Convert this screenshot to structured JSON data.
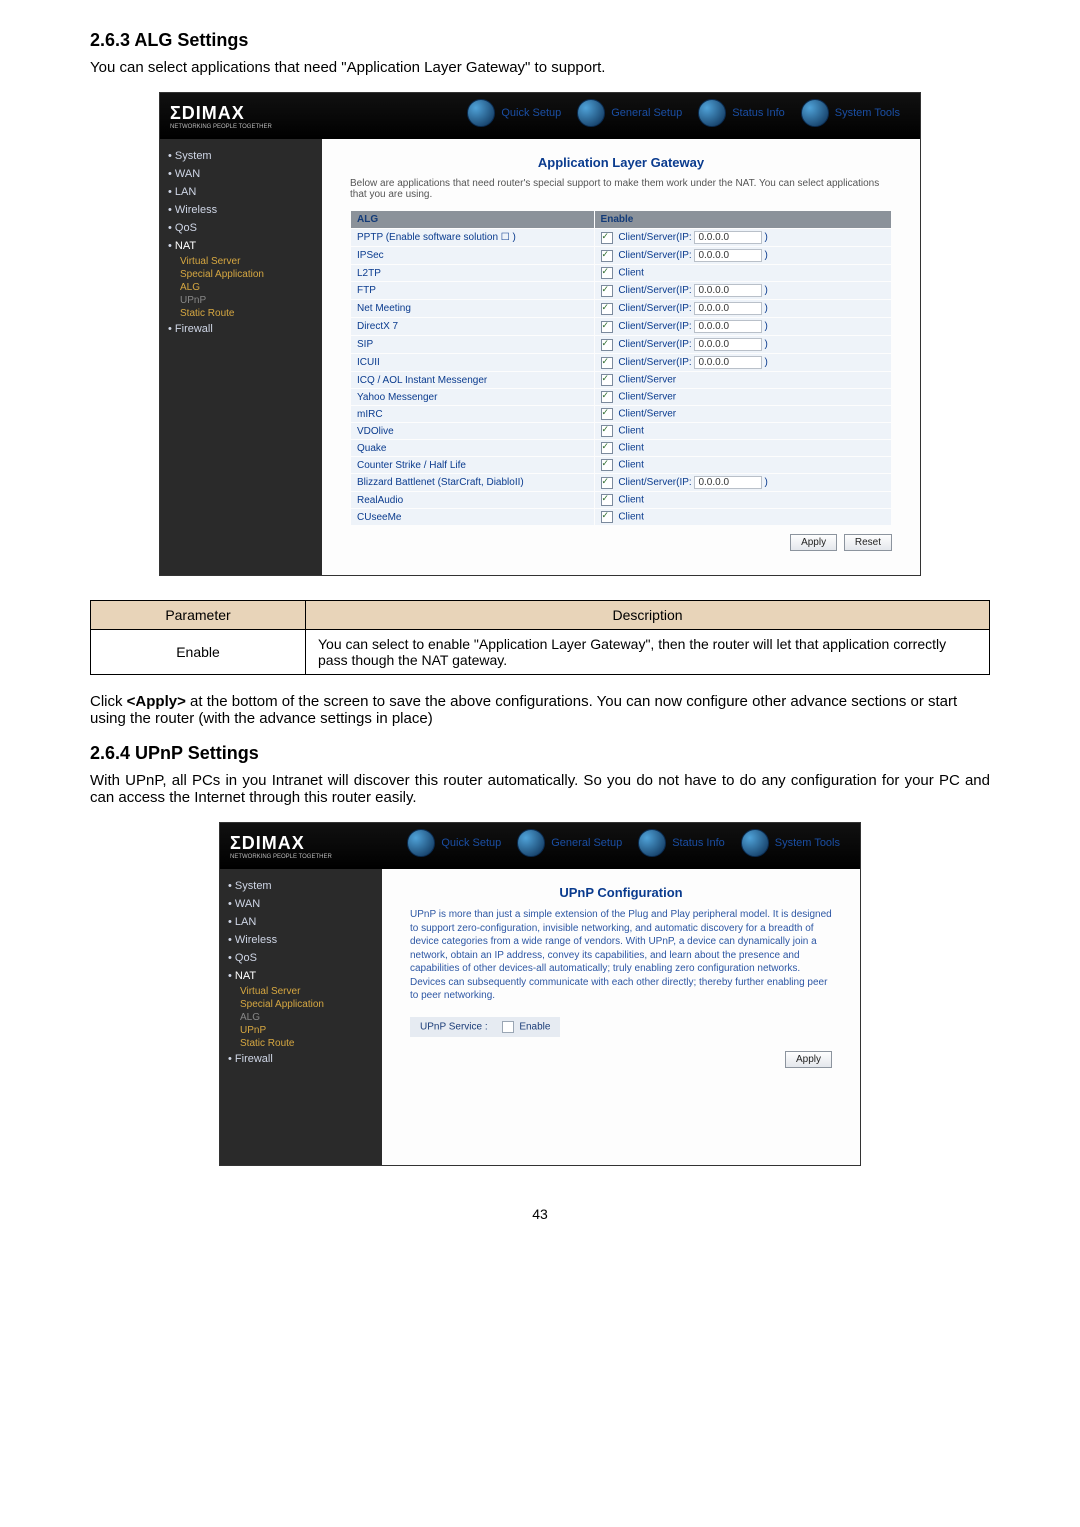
{
  "s263_heading": "2.6.3 ALG Settings",
  "s263_intro": "You can select applications that need \"Application Layer Gateway\" to support.",
  "brand": "ΣDIMAX",
  "brand_sub": "NETWORKING PEOPLE TOGETHER",
  "top_tabs": {
    "quick": "Quick Setup",
    "general": "General Setup",
    "status": "Status Info",
    "tools": "System Tools"
  },
  "nav": {
    "system": "System",
    "wan": "WAN",
    "lan": "LAN",
    "wireless": "Wireless",
    "qos": "QoS",
    "nat": "NAT",
    "virtual": "Virtual Server",
    "special": "Special Application",
    "alg": "ALG",
    "upnp": "UPnP",
    "static_route": "Static Route",
    "firewall": "Firewall"
  },
  "alg": {
    "title": "Application Layer Gateway",
    "desc": "Below are applications that need router's special support to make them work under the NAT. You can select applications that you are using.",
    "col_alg": "ALG",
    "col_enable": "Enable",
    "rows": [
      {
        "name": "PPTP (Enable software solution ☐ )",
        "enable_label": "Client/Server(IP:",
        "ip": "0.0.0.0",
        "hasip": true
      },
      {
        "name": "IPSec",
        "enable_label": "Client/Server(IP:",
        "ip": "0.0.0.0",
        "hasip": true
      },
      {
        "name": "L2TP",
        "enable_label": "Client",
        "hasip": false
      },
      {
        "name": "FTP",
        "enable_label": "Client/Server(IP:",
        "ip": "0.0.0.0",
        "hasip": true
      },
      {
        "name": "Net Meeting",
        "enable_label": "Client/Server(IP:",
        "ip": "0.0.0.0",
        "hasip": true
      },
      {
        "name": "DirectX 7",
        "enable_label": "Client/Server(IP:",
        "ip": "0.0.0.0",
        "hasip": true
      },
      {
        "name": "SIP",
        "enable_label": "Client/Server(IP:",
        "ip": "0.0.0.0",
        "hasip": true
      },
      {
        "name": "ICUII",
        "enable_label": "Client/Server(IP:",
        "ip": "0.0.0.0",
        "hasip": true
      },
      {
        "name": "ICQ / AOL Instant Messenger",
        "enable_label": "Client/Server",
        "hasip": false
      },
      {
        "name": "Yahoo Messenger",
        "enable_label": "Client/Server",
        "hasip": false
      },
      {
        "name": "mIRC",
        "enable_label": "Client/Server",
        "hasip": false
      },
      {
        "name": "VDOlive",
        "enable_label": "Client",
        "hasip": false
      },
      {
        "name": "Quake",
        "enable_label": "Client",
        "hasip": false
      },
      {
        "name": "Counter Strike / Half Life",
        "enable_label": "Client",
        "hasip": false
      },
      {
        "name": "Blizzard Battlenet (StarCraft, DiabloII)",
        "enable_label": "Client/Server(IP:",
        "ip": "0.0.0.0",
        "hasip": true
      },
      {
        "name": "RealAudio",
        "enable_label": "Client",
        "hasip": false
      },
      {
        "name": "CUseeMe",
        "enable_label": "Client",
        "hasip": false
      }
    ],
    "apply": "Apply",
    "reset": "Reset"
  },
  "param_header_param": "Parameter",
  "param_header_desc": "Description",
  "param_row_label": "Enable",
  "param_row_desc": "You can select to enable \"Application Layer Gateway\", then the router will let that application correctly pass though the NAT gateway.",
  "apply_note_prefix": "Click ",
  "apply_note_bold": "<Apply>",
  "apply_note_suffix": " at the bottom of the screen to save the above configurations. You can now configure other advance sections or start using the router (with the advance settings in place)",
  "s264_heading": "2.6.4 UPnP Settings",
  "s264_intro": "With UPnP, all PCs in you Intranet will discover this router automatically. So you do not have to do any configuration for your PC and can access the Internet through this router easily.",
  "upnp": {
    "title": "UPnP Configuration",
    "desc": "UPnP is more than just a simple extension of the Plug and Play peripheral model. It is designed to support zero-configuration, invisible networking, and automatic discovery for a breadth of device categories from a wide range of vendors. With UPnP, a device can dynamically join a network, obtain an IP address, convey its capabilities, and learn about the presence and capabilities of other devices-all automatically; truly enabling zero configuration networks. Devices can subsequently communicate with each other directly; thereby further enabling peer to peer networking.",
    "service_label": "UPnP Service :",
    "enable_label": "Enable",
    "apply": "Apply"
  },
  "page_number": "43"
}
